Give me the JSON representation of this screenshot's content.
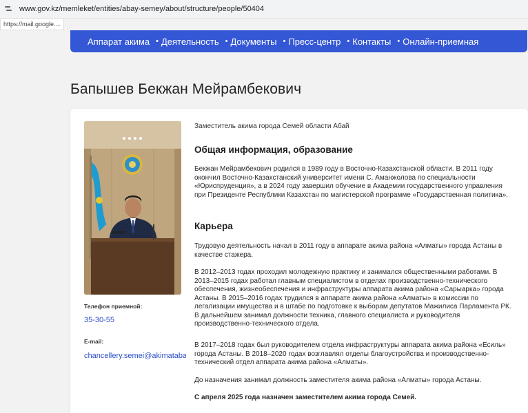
{
  "browser": {
    "url": "www.gov.kz/memleket/entities/abay-semey/about/structure/people/50404",
    "status_url": "https://mail.google...."
  },
  "nav": {
    "items": [
      "Аппарат акима",
      "Деятельность",
      "Документы",
      "Пресс-центр",
      "Контакты",
      "Онлайн-приемная"
    ],
    "separator": "•",
    "background": "#3457d5"
  },
  "person": {
    "name": "Бапышев Бекжан Мейрамбекович",
    "position": "Заместитель акима города Семей области Абай"
  },
  "contacts": {
    "phone_label": "Телефон приемной:",
    "phone": "35-30-55",
    "email_label": "E-mail:",
    "email": "chancellery.semei@akimatabai.gov.kz"
  },
  "sections": {
    "general_title": "Общая информация, образование",
    "general_text": "Бекжан Мейрамбекович родился в 1989 году в Восточно-Казахстанской области. В 2011 году окончил Восточно-Казахстанский университет имени С. Аманжолова по специальности «Юриспруденция», а в 2024 году завершил обучение в Академии государственного управления при Президенте Республики Казахстан по магистерской программе «Государственная политика».",
    "career_title": "Карьера",
    "career_p1": "Трудовую деятельность начал в 2011 году в аппарате акима района «Алматы» города Астаны в качестве стажера.",
    "career_p2": "В 2012–2013 годах проходил молодежную практику и занимался общественными работами. В 2013–2015 годах работал главным специалистом в отделах производственно-технического обеспечения, жизнеобеспечения и инфраструктуры аппарата акима района «Сарыарка» города Астаны. В 2015–2016 годах трудился в аппарате акима района «Алматы» в комиссии по легализации имущества и в штабе по подготовке к выборам депутатов Мажилиса Парламента РК. В дальнейшем занимал должности техника, главного специалиста и руководителя производственно-технического отдела.",
    "career_p3": "В 2017–2018 годах был руководителем отдела инфраструктуры аппарата акима района «Есиль» города Астаны. В 2018–2020 годах возглавлял отделы благоустройства и производственно-технический отдел аппарата акима района «Алматы».",
    "career_p4": "До назначения занимал должность заместителя акима района «Алматы» города Астаны.",
    "career_p5": "С апреля 2025 года назначен заместителем акима города Семей."
  }
}
